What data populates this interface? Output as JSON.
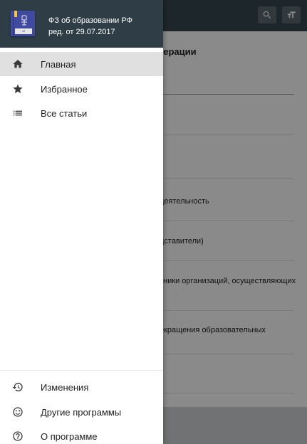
{
  "header": {
    "title": "ФЗ об образовании РФ",
    "subtitle": "ред. от 29.07.2017",
    "book_label": "об образовании"
  },
  "nav_primary": [
    {
      "label": "Главная",
      "icon": "home-icon",
      "active": true
    },
    {
      "label": "Избранное",
      "icon": "star-icon",
      "active": false
    },
    {
      "label": "Все статьи",
      "icon": "list-icon",
      "active": false
    }
  ],
  "nav_secondary": [
    {
      "label": "Изменения",
      "icon": "history-icon"
    },
    {
      "label": "Другие программы",
      "icon": "smiley-icon"
    },
    {
      "label": "О программе",
      "icon": "help-icon"
    }
  ],
  "background": {
    "toolbar_icons": [
      "search-icon",
      "text-size-icon"
    ],
    "heading": "дерации",
    "items": [
      "деятельность",
      "дставители)",
      "тники организаций, осуществляющих",
      "екращения образовательных"
    ]
  },
  "colors": {
    "toolbar": "#37474f",
    "drawer_header": "#2f3d46",
    "active_item": "#e0e0e0",
    "book": "#3f4aa0"
  }
}
